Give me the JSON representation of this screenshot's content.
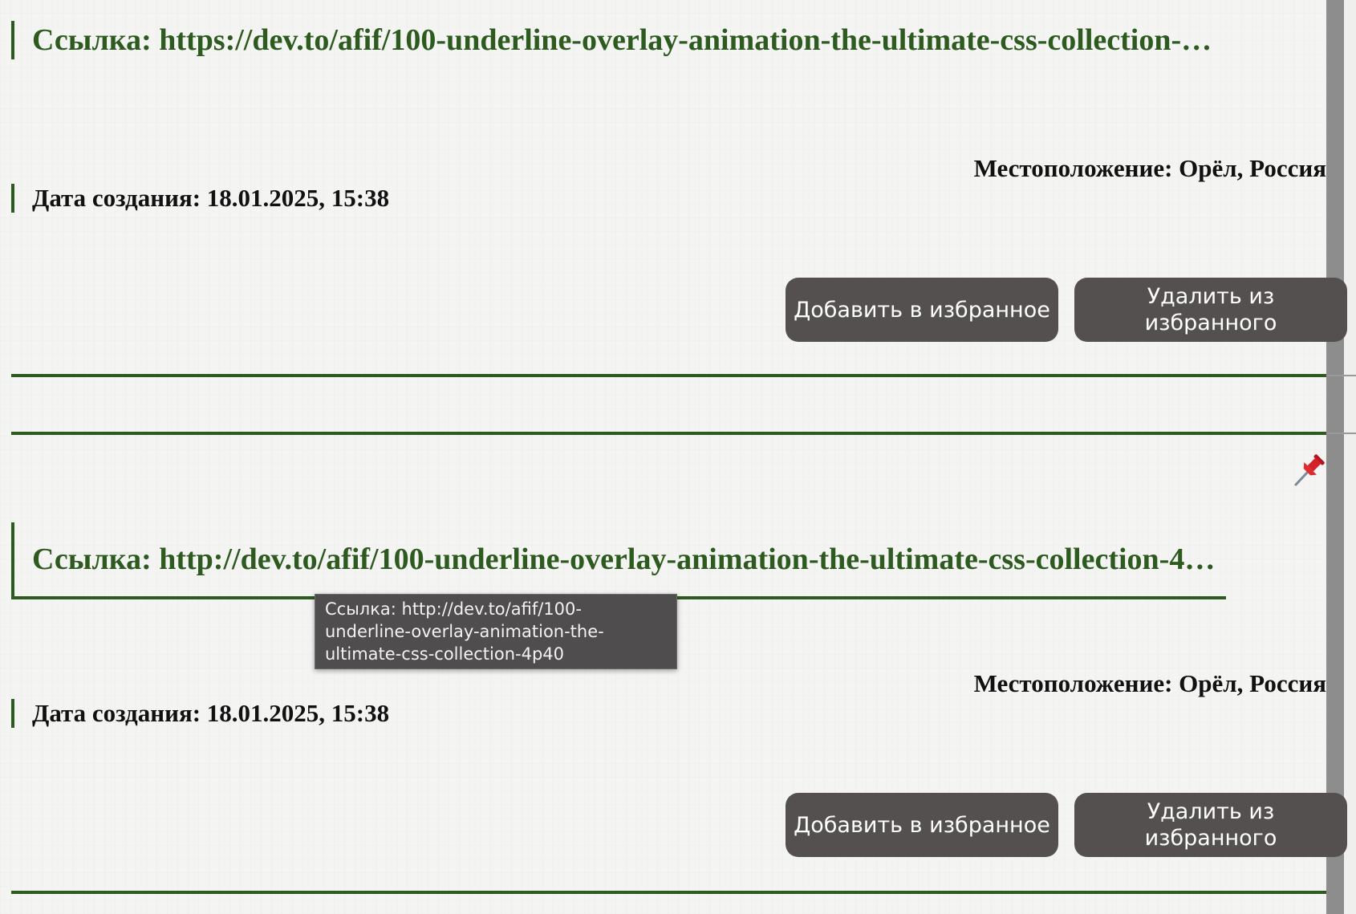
{
  "cards": [
    {
      "link": "Ссылка: https://dev.to/afif/100-underline-overlay-animation-the-ultimate-css-collection-…",
      "location": "Местоположение: Орёл, Россия",
      "date": "Дата создания: 18.01.2025, 15:38",
      "add_button": "Добавить в избранное",
      "remove_button": "Удалить из избранного"
    },
    {
      "link": "Ссылка: http://dev.to/afif/100-underline-overlay-animation-the-ultimate-css-collection-4…",
      "location": "Местоположение: Орёл, Россия",
      "date": "Дата создания: 18.01.2025, 15:38",
      "add_button": "Добавить в избранное",
      "remove_button": "Удалить из избранного",
      "pinned_icon": "pushpin-icon"
    }
  ],
  "tooltip": {
    "text": "Ссылка: http://dev.to/afif/100-underline-overlay-animation-the-ultimate-css-collection-4p40"
  },
  "colors": {
    "accent_green": "#2d5a1f",
    "button_bg": "#545050",
    "button_text": "#ffffff",
    "tooltip_bg": "#4f4d4d",
    "pin_red": "#d42027"
  }
}
